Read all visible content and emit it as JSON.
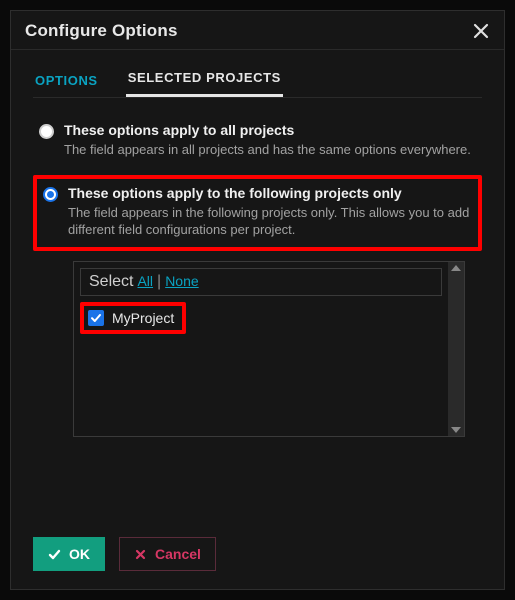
{
  "dialog": {
    "title": "Configure Options"
  },
  "tabs": {
    "options": "OPTIONS",
    "selected_projects": "SELECTED PROJECTS"
  },
  "scope": {
    "all": {
      "title": "These options apply to all projects",
      "desc": "The field appears in all projects and has the same options everywhere."
    },
    "selected": {
      "title": "These options apply to the following projects only",
      "desc": "The field appears in the following projects only. This allows you to add different field configurations per project."
    }
  },
  "selectBar": {
    "label": "Select",
    "all": "All",
    "none": "None"
  },
  "projects": [
    {
      "name": "MyProject",
      "checked": true
    }
  ],
  "buttons": {
    "ok": "OK",
    "cancel": "Cancel"
  }
}
